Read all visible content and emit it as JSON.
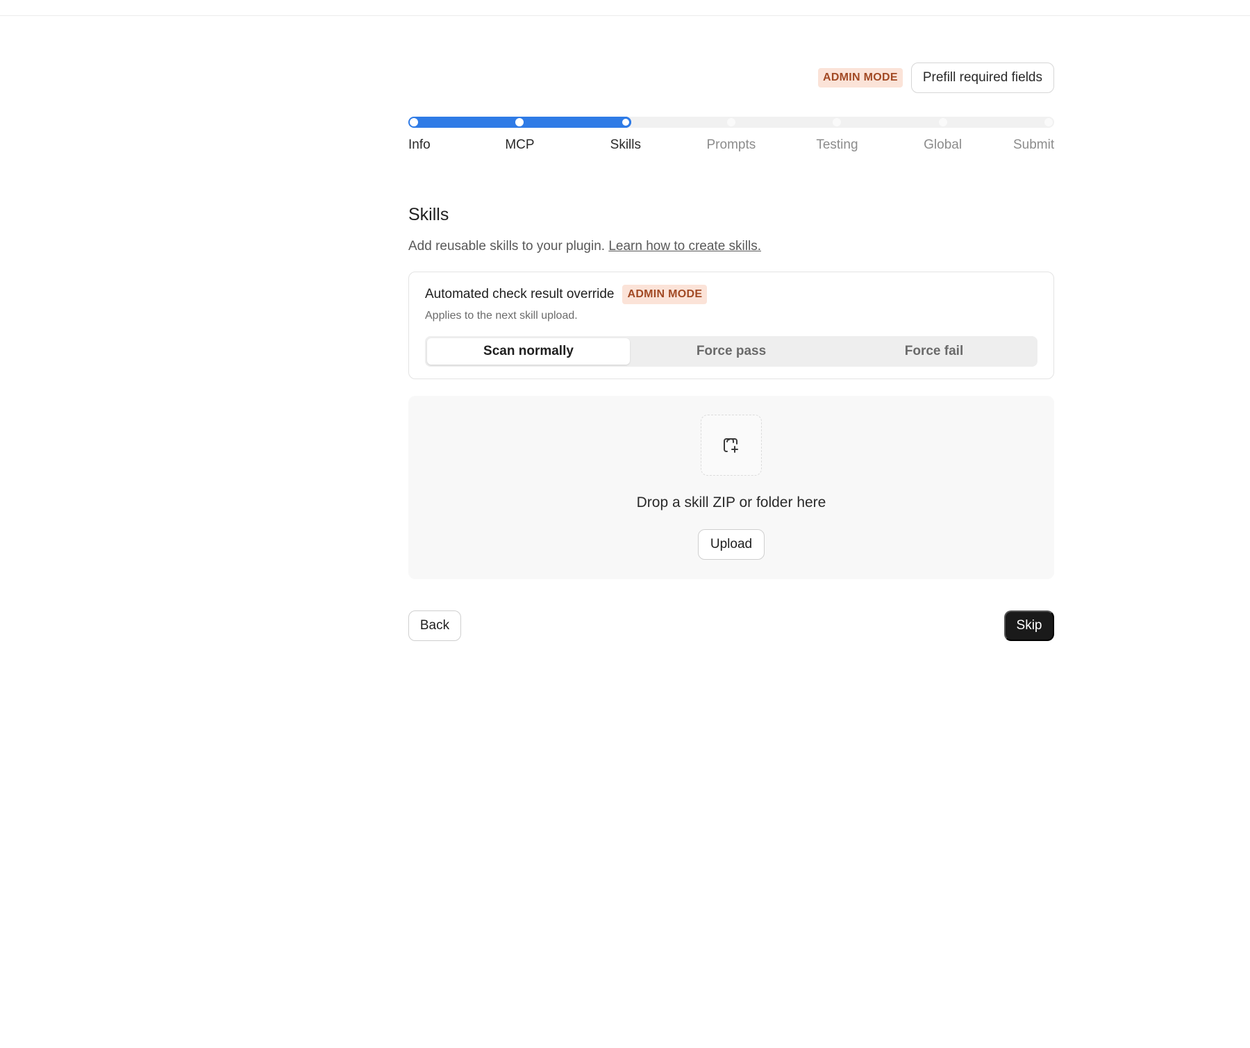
{
  "header": {
    "admin_badge": "ADMIN MODE",
    "prefill_label": "Prefill required fields"
  },
  "stepper": {
    "current_step_index": 2,
    "steps": [
      {
        "label": "Info",
        "state": "done"
      },
      {
        "label": "MCP",
        "state": "done"
      },
      {
        "label": "Skills",
        "state": "current"
      },
      {
        "label": "Prompts",
        "state": "todo"
      },
      {
        "label": "Testing",
        "state": "todo"
      },
      {
        "label": "Global",
        "state": "todo"
      },
      {
        "label": "Submit",
        "state": "todo"
      }
    ]
  },
  "section": {
    "title": "Skills",
    "description": "Add reusable skills to your plugin.",
    "link_text": "Learn how to create skills."
  },
  "override": {
    "title": "Automated check result override",
    "badge": "ADMIN MODE",
    "subtitle": "Applies to the next skill upload.",
    "options": [
      "Scan normally",
      "Force pass",
      "Force fail"
    ],
    "selected": "Scan normally"
  },
  "dropzone": {
    "icon": "skill-upload-icon",
    "text": "Drop a skill ZIP or folder here",
    "upload_label": "Upload"
  },
  "footer": {
    "back_label": "Back",
    "skip_label": "Skip"
  },
  "colors": {
    "accent": "#2f7be6",
    "admin_badge_bg": "#fbe3d8",
    "admin_badge_text": "#a24a25",
    "primary_button": "#1a1a1a"
  }
}
